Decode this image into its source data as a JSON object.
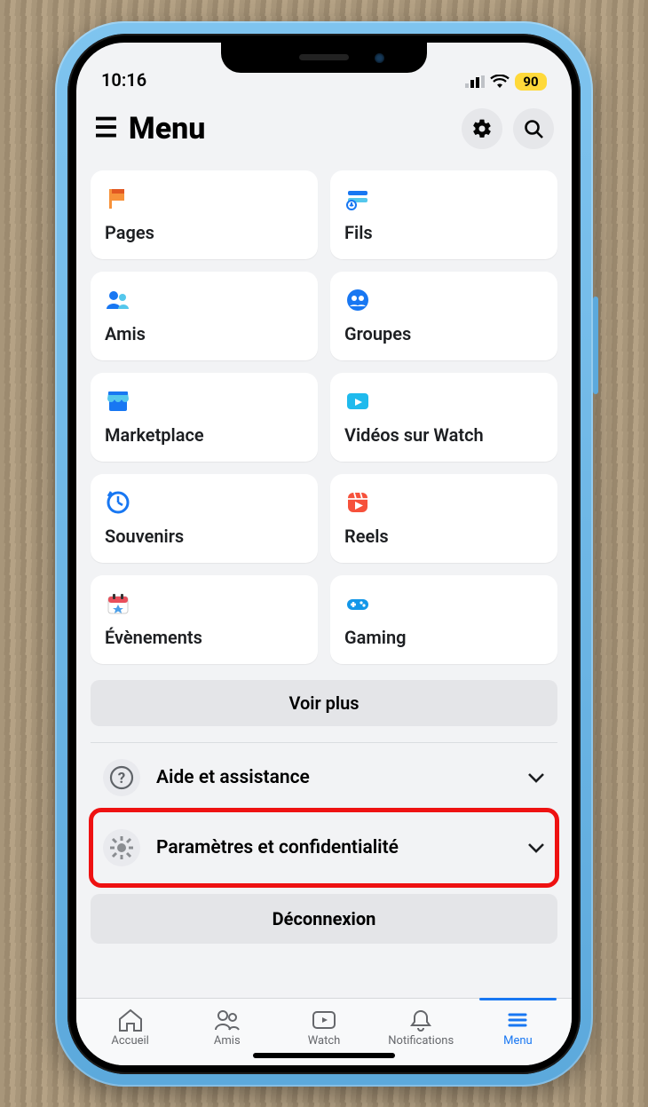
{
  "status": {
    "time": "10:16",
    "battery_percent": "90"
  },
  "header": {
    "title": "Menu"
  },
  "shortcuts": [
    {
      "id": "pages",
      "label": "Pages",
      "icon": "flag"
    },
    {
      "id": "feeds",
      "label": "Fils",
      "icon": "feeds"
    },
    {
      "id": "friends",
      "label": "Amis",
      "icon": "friends"
    },
    {
      "id": "groups",
      "label": "Groupes",
      "icon": "groups"
    },
    {
      "id": "marketplace",
      "label": "Marketplace",
      "icon": "store"
    },
    {
      "id": "watch",
      "label": "Vidéos sur Watch",
      "icon": "watch"
    },
    {
      "id": "memories",
      "label": "Souvenirs",
      "icon": "clock"
    },
    {
      "id": "reels",
      "label": "Reels",
      "icon": "reels"
    },
    {
      "id": "events",
      "label": "Évènements",
      "icon": "events"
    },
    {
      "id": "gaming",
      "label": "Gaming",
      "icon": "gaming"
    }
  ],
  "see_more": "Voir plus",
  "rows": [
    {
      "id": "help",
      "label": "Aide et assistance",
      "icon": "help",
      "highlighted": false
    },
    {
      "id": "settings",
      "label": "Paramètres et confidentialité",
      "icon": "settings",
      "highlighted": true
    }
  ],
  "logout": "Déconnexion",
  "nav": [
    {
      "id": "home",
      "label": "Accueil",
      "active": false
    },
    {
      "id": "friends",
      "label": "Amis",
      "active": false
    },
    {
      "id": "watch",
      "label": "Watch",
      "active": false
    },
    {
      "id": "notifications",
      "label": "Notifications",
      "active": false
    },
    {
      "id": "menu",
      "label": "Menu",
      "active": true
    }
  ],
  "icons": {
    "settings": "gear-icon",
    "search": "search-icon"
  }
}
